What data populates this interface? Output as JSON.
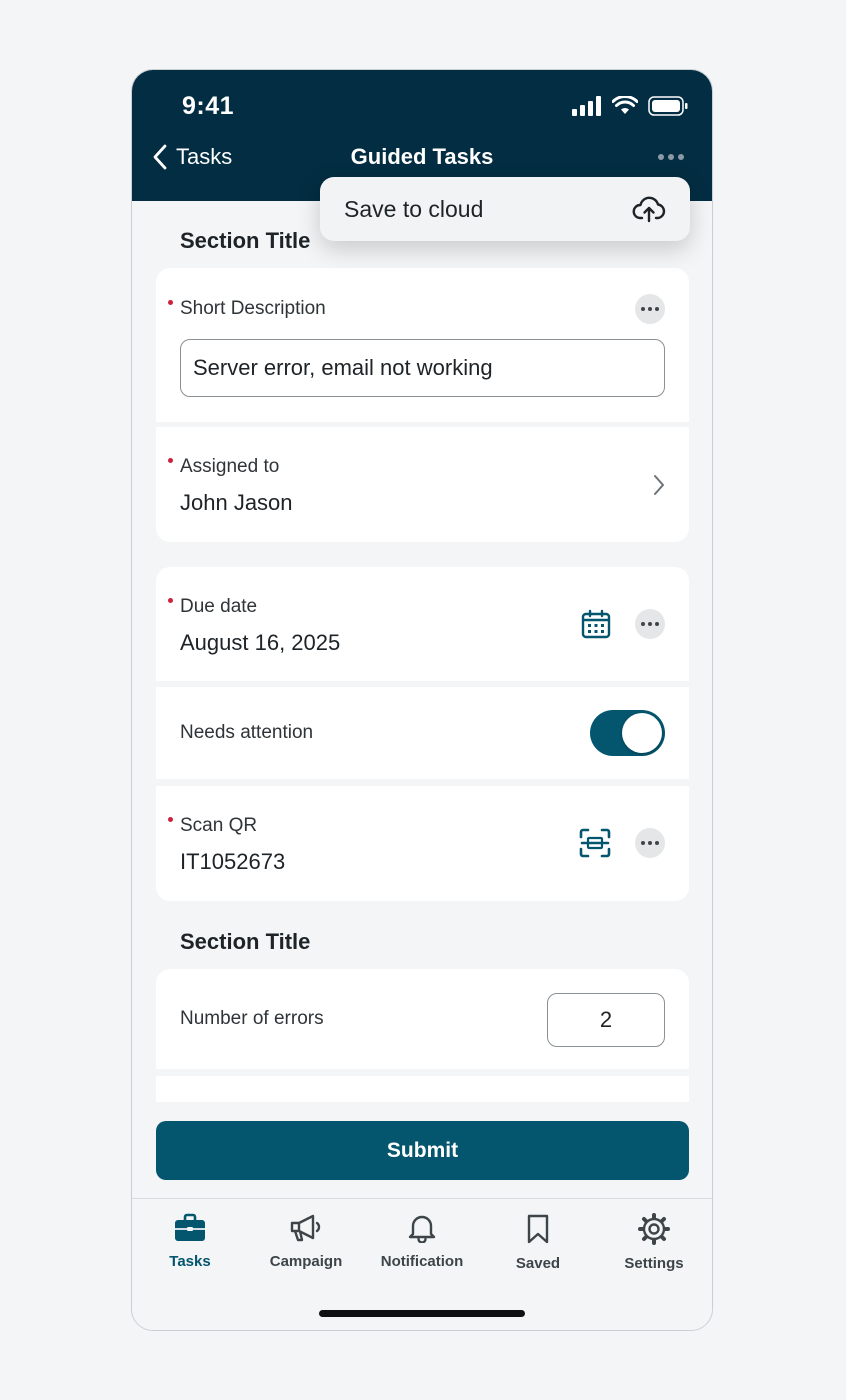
{
  "status": {
    "time": "9:41"
  },
  "nav": {
    "back_label": "Tasks",
    "title": "Guided Tasks"
  },
  "menu": {
    "save_label": "Save to cloud"
  },
  "sections": [
    {
      "title": "Section Title"
    },
    {
      "title": "Section Title"
    }
  ],
  "fields": {
    "short_description": {
      "label": "Short Description",
      "value": "Server error, email not working"
    },
    "assigned_to": {
      "label": "Assigned to",
      "value": "John Jason"
    },
    "due_date": {
      "label": "Due date",
      "value": "August 16, 2025"
    },
    "needs_attention": {
      "label": "Needs attention",
      "on": true
    },
    "scan_qr": {
      "label": "Scan QR",
      "value": "IT1052673"
    },
    "number_of_errors": {
      "label": "Number of errors",
      "value": "2"
    }
  },
  "submit_label": "Submit",
  "tabs": [
    {
      "label": "Tasks",
      "icon": "briefcase-icon",
      "active": true
    },
    {
      "label": "Campaign",
      "icon": "megaphone-icon",
      "active": false
    },
    {
      "label": "Notification",
      "icon": "bell-icon",
      "active": false
    },
    {
      "label": "Saved",
      "icon": "bookmark-icon",
      "active": false
    },
    {
      "label": "Settings",
      "icon": "gear-icon",
      "active": false
    }
  ],
  "colors": {
    "header_bg": "#032d42",
    "accent": "#04566e",
    "required_dot": "#d0213c",
    "background": "#f3f5f7"
  }
}
